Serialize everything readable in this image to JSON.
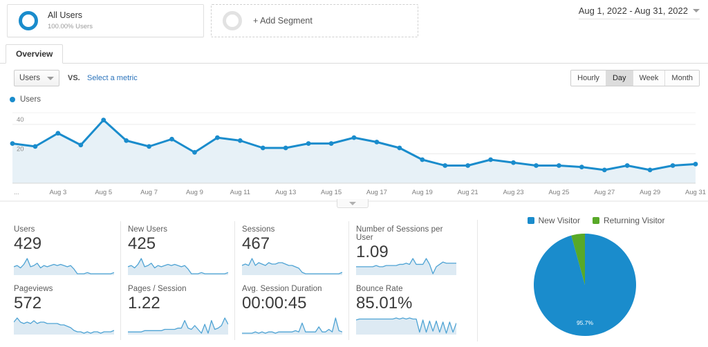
{
  "segments": {
    "all_users": {
      "title": "All Users",
      "subtitle": "100.00% Users",
      "icon": "ring-icon"
    },
    "add_segment": {
      "label": "+ Add Segment",
      "icon": "empty-ring-icon"
    }
  },
  "date_range": {
    "label": "Aug 1, 2022 - Aug 31, 2022",
    "icon": "caret-down-icon"
  },
  "tabs": [
    {
      "label": "Overview",
      "active": true
    }
  ],
  "metric_selector": {
    "selected_metric": "Users",
    "vs_label": "VS.",
    "select_metric_link": "Select a metric",
    "caret_icon": "caret-down-icon"
  },
  "granularity": {
    "options": [
      "Hourly",
      "Day",
      "Week",
      "Month"
    ],
    "selected": "Day"
  },
  "chart_legend": {
    "label": "Users",
    "color": "#1a8ccc"
  },
  "chart_collapse": {
    "icon": "caret-down-icon"
  },
  "cards": [
    {
      "label": "Users",
      "value": "429"
    },
    {
      "label": "New Users",
      "value": "425"
    },
    {
      "label": "Sessions",
      "value": "467"
    },
    {
      "label": "Number of Sessions per User",
      "value": "1.09"
    },
    {
      "label": "Pageviews",
      "value": "572"
    },
    {
      "label": "Pages / Session",
      "value": "1.22"
    },
    {
      "label": "Avg. Session Duration",
      "value": "00:00:45"
    },
    {
      "label": "Bounce Rate",
      "value": "85.01%"
    }
  ],
  "pie_legend": [
    {
      "label": "New Visitor",
      "color": "#1a8ccc"
    },
    {
      "label": "Returning Visitor",
      "color": "#58a928"
    }
  ],
  "chart_data": [
    {
      "type": "line",
      "title": "Users",
      "xlabel": "",
      "ylabel": "Users",
      "ylim": [
        0,
        48
      ],
      "yticks": [
        20,
        40
      ],
      "ytick_labels": [
        "20",
        "40"
      ],
      "grid": true,
      "legend": "Users",
      "axis_prefix_label": "...",
      "categories": [
        "Aug 1",
        "Aug 2",
        "Aug 3",
        "Aug 4",
        "Aug 5",
        "Aug 6",
        "Aug 7",
        "Aug 8",
        "Aug 9",
        "Aug 10",
        "Aug 11",
        "Aug 12",
        "Aug 13",
        "Aug 14",
        "Aug 15",
        "Aug 16",
        "Aug 17",
        "Aug 18",
        "Aug 19",
        "Aug 20",
        "Aug 21",
        "Aug 22",
        "Aug 23",
        "Aug 24",
        "Aug 25",
        "Aug 26",
        "Aug 27",
        "Aug 28",
        "Aug 29",
        "Aug 30",
        "Aug 31"
      ],
      "tick_labels": [
        "Aug 3",
        "Aug 5",
        "Aug 7",
        "Aug 9",
        "Aug 11",
        "Aug 13",
        "Aug 15",
        "Aug 17",
        "Aug 19",
        "Aug 21",
        "Aug 23",
        "Aug 25",
        "Aug 27",
        "Aug 29",
        "Aug 31"
      ],
      "series": [
        {
          "name": "Users",
          "color": "#1a8ccc",
          "values": [
            27,
            25,
            34,
            26,
            43,
            29,
            25,
            30,
            21,
            31,
            29,
            24,
            24,
            27,
            27,
            31,
            28,
            24,
            16,
            12,
            12,
            16,
            14,
            12,
            12,
            11,
            9,
            12,
            9,
            12,
            13
          ]
        }
      ]
    },
    {
      "type": "pie",
      "title": "New vs Returning",
      "labels": [
        "New Visitor",
        "Returning Visitor"
      ],
      "values": [
        95.7,
        4.3
      ],
      "colors": [
        "#1a8ccc",
        "#58a928"
      ],
      "data_label": "95.7%",
      "legend_position": "top"
    },
    {
      "type": "line",
      "title": "Users sparkline",
      "values": [
        12,
        13,
        11,
        14,
        19,
        12,
        13,
        15,
        11,
        13,
        12,
        13,
        14,
        13,
        14,
        13,
        12,
        13,
        10,
        6,
        6,
        6,
        7,
        6,
        6,
        6,
        6,
        6,
        6,
        6,
        7
      ]
    },
    {
      "type": "line",
      "title": "New Users sparkline",
      "values": [
        12,
        13,
        11,
        14,
        19,
        12,
        13,
        15,
        11,
        13,
        12,
        13,
        14,
        13,
        14,
        13,
        12,
        13,
        10,
        6,
        6,
        6,
        7,
        6,
        6,
        6,
        6,
        6,
        6,
        6,
        7
      ]
    },
    {
      "type": "line",
      "title": "Sessions sparkline",
      "values": [
        12,
        13,
        12,
        17,
        12,
        14,
        13,
        12,
        14,
        13,
        13,
        14,
        14,
        13,
        12,
        12,
        11,
        10,
        7,
        6,
        6,
        6,
        6,
        6,
        6,
        6,
        6,
        6,
        6,
        6,
        7
      ]
    },
    {
      "type": "line",
      "title": "Number of Sessions per User sparkline",
      "values": [
        9,
        9,
        9,
        9,
        9,
        9,
        10,
        9,
        9,
        10,
        10,
        10,
        10,
        11,
        11,
        12,
        11,
        16,
        11,
        11,
        11,
        16,
        11,
        3,
        9,
        11,
        13,
        12,
        12,
        12,
        12
      ]
    },
    {
      "type": "line",
      "title": "Pageviews sparkline",
      "values": [
        13,
        16,
        13,
        12,
        13,
        12,
        14,
        12,
        13,
        13,
        12,
        12,
        12,
        12,
        11,
        11,
        10,
        9,
        7,
        6,
        6,
        5,
        6,
        5,
        6,
        6,
        5,
        6,
        6,
        6,
        7
      ]
    },
    {
      "type": "line",
      "title": "Pages / Session sparkline",
      "values": [
        7,
        7,
        7,
        7,
        7,
        8,
        8,
        8,
        8,
        8,
        8,
        9,
        9,
        9,
        9,
        10,
        10,
        16,
        10,
        9,
        12,
        9,
        6,
        13,
        6,
        16,
        9,
        10,
        12,
        18,
        13
      ]
    },
    {
      "type": "line",
      "title": "Avg. Session Duration sparkline",
      "values": [
        6,
        6,
        6,
        6,
        7,
        6,
        7,
        6,
        7,
        7,
        6,
        7,
        7,
        7,
        7,
        7,
        8,
        7,
        14,
        7,
        7,
        7,
        7,
        11,
        7,
        7,
        9,
        7,
        18,
        8,
        7
      ]
    },
    {
      "type": "line",
      "title": "Bounce Rate sparkline",
      "values": [
        18,
        19,
        19,
        19,
        19,
        19,
        19,
        19,
        19,
        19,
        19,
        19,
        20,
        19,
        20,
        19,
        20,
        19,
        19,
        6,
        18,
        6,
        17,
        7,
        17,
        6,
        16,
        5,
        16,
        6,
        15
      ]
    }
  ]
}
